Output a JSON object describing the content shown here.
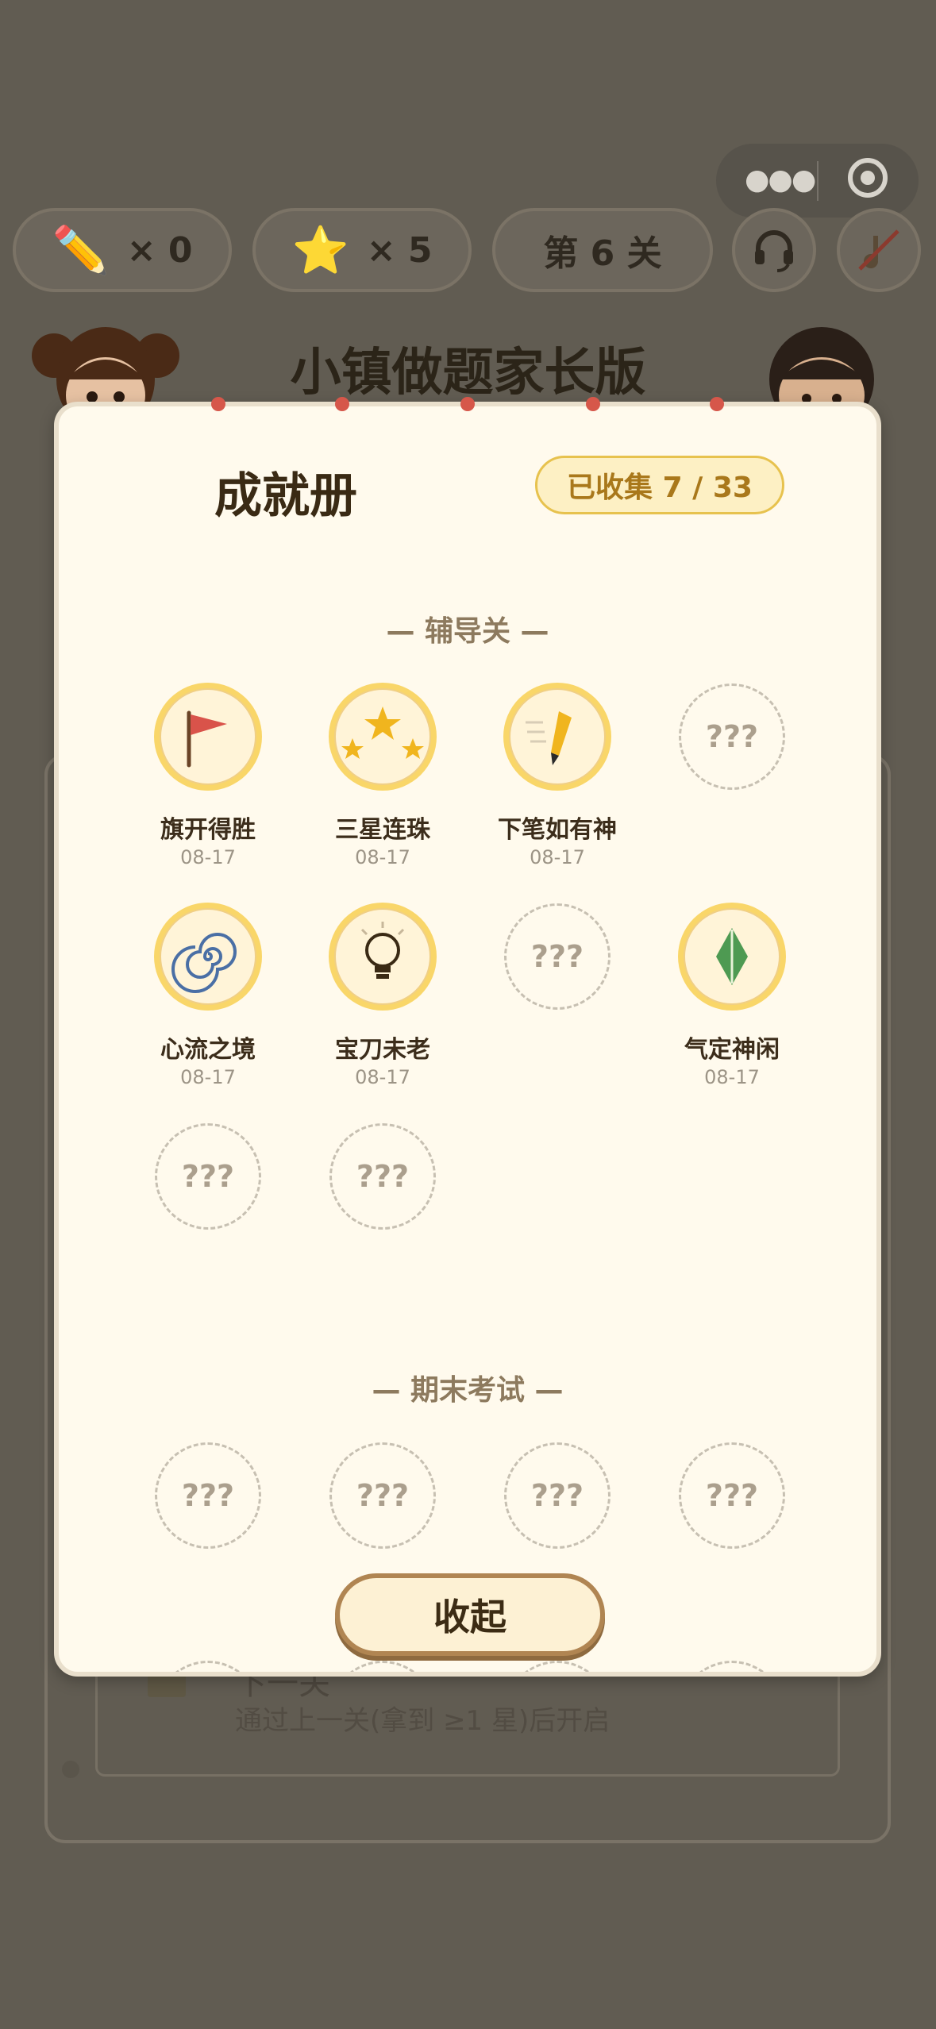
{
  "header": {
    "menu_icon": "more-dots-icon",
    "target_icon": "target-icon",
    "pencil_count": "× 0",
    "star_count": "× 5",
    "level": "第 6 关"
  },
  "background": {
    "title": "小镇做题家长版",
    "locked_title": "下一关",
    "locked_text": "通过上一关(拿到 ≥1 星)后开启"
  },
  "modal": {
    "title": "成就册",
    "collected": "已收集 7 / 33",
    "section1_title": "— 辅导关 —",
    "section2_title": "— 期末考试 —",
    "medals": [
      {
        "name": "旗开得胜",
        "date": "08-17",
        "icon": "flag-icon"
      },
      {
        "name": "三星连珠",
        "date": "08-17",
        "icon": "three-stars-icon"
      },
      {
        "name": "下笔如有神",
        "date": "08-17",
        "icon": "pencil-icon"
      },
      {
        "locked_text": "???"
      },
      {
        "name": "心流之境",
        "date": "08-17",
        "icon": "spiral-icon"
      },
      {
        "name": "宝刀未老",
        "date": "08-17",
        "icon": "bulb-icon"
      },
      {
        "locked_text": "???"
      },
      {
        "name": "气定神闲",
        "date": "08-17",
        "icon": "leaf-icon"
      },
      {
        "locked_text": "???"
      },
      {
        "locked_text": "???"
      }
    ],
    "exam_medals": [
      {
        "locked_text": "???"
      },
      {
        "locked_text": "???"
      },
      {
        "locked_text": "???"
      },
      {
        "locked_text": "???"
      }
    ],
    "collapse_label": "收起"
  },
  "colors": {
    "overlay": "#615c52",
    "modal_bg": "#fffaed",
    "medal_gold": "#f9d669",
    "accent_text": "#a9781b"
  }
}
